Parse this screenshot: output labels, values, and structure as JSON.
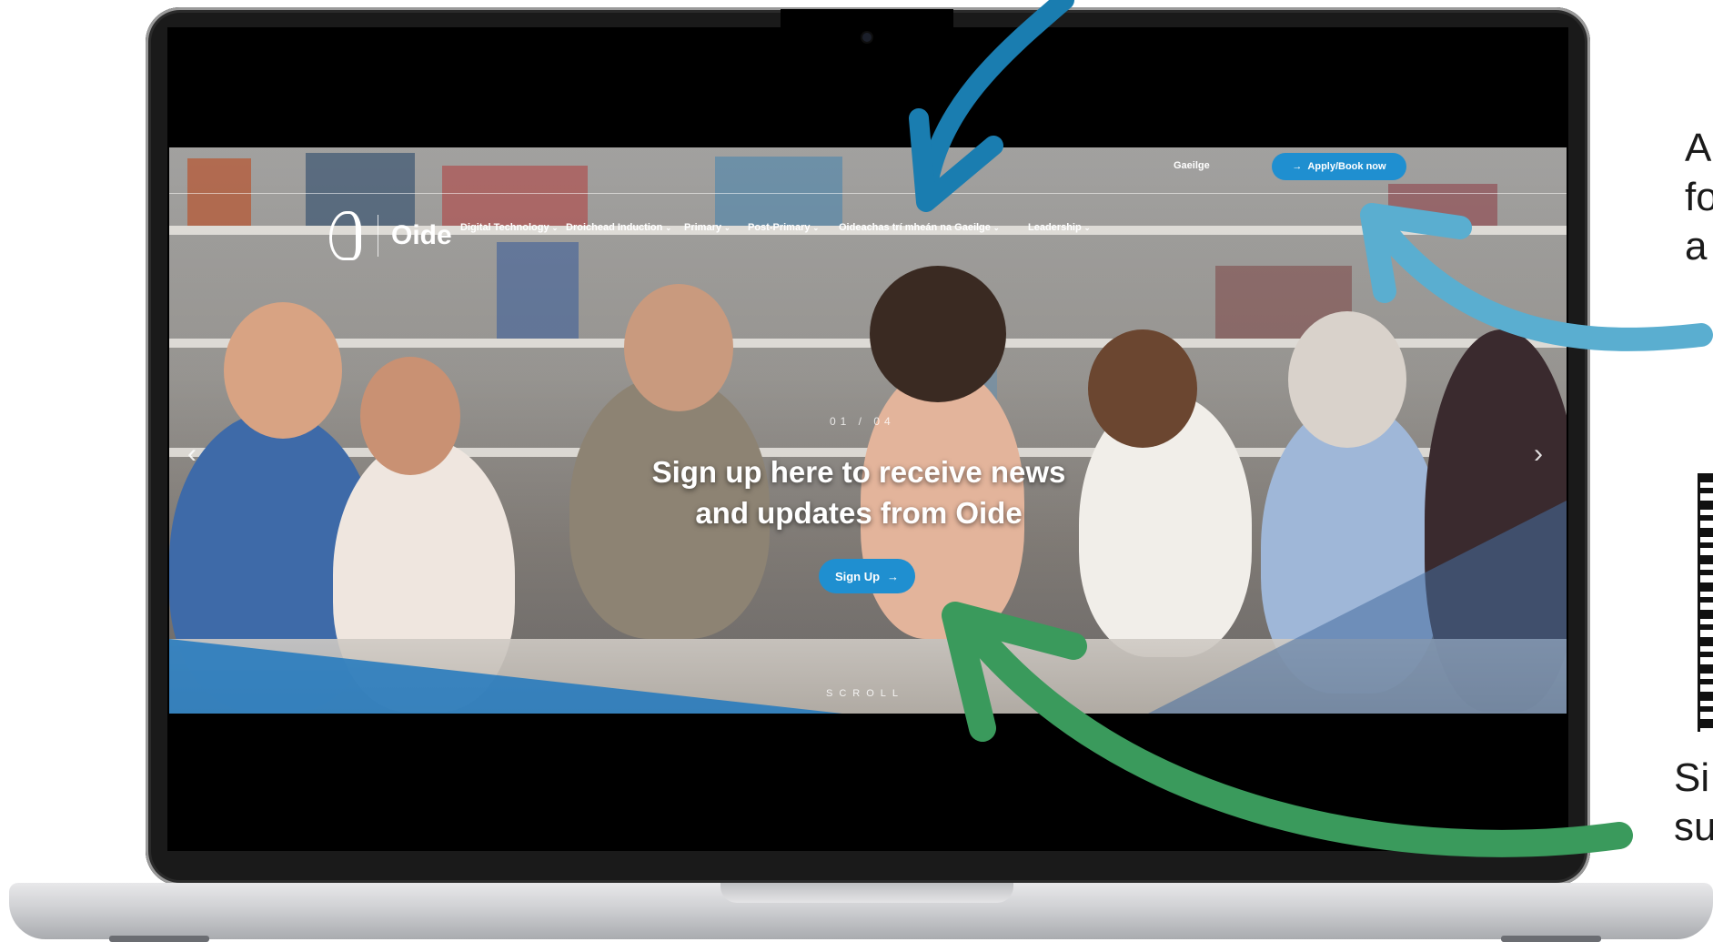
{
  "website": {
    "logo_text": "Oide",
    "language_link": "Gaeilge",
    "apply_button": "Apply/Book now",
    "apply_icon": "arrow-right-icon",
    "nav": [
      {
        "label": "Digital Technology"
      },
      {
        "label": "Droichead Induction"
      },
      {
        "label": "Primary"
      },
      {
        "label": "Post-Primary"
      },
      {
        "label": "Oideachas trí mheán na Gaeilge"
      },
      {
        "label": "Leadership"
      }
    ],
    "slide_counter": "01 / 04",
    "headline_line1": "Sign up here to receive news",
    "headline_line2": "and updates from Oide",
    "signup_button": "Sign Up",
    "scroll_label": "SCROLL",
    "prev_glyph": "‹",
    "next_glyph": "›",
    "accent_color": "#1f8fd0"
  },
  "annotations": {
    "right_top_line1": "A",
    "right_top_line2": "fo",
    "right_top_line3": "a",
    "right_bottom_line1": "Si",
    "right_bottom_line2": "su",
    "arrow_colors": {
      "top": "#1a7db0",
      "middle": "#5aaed0",
      "bottom": "#3a9a5c"
    }
  }
}
